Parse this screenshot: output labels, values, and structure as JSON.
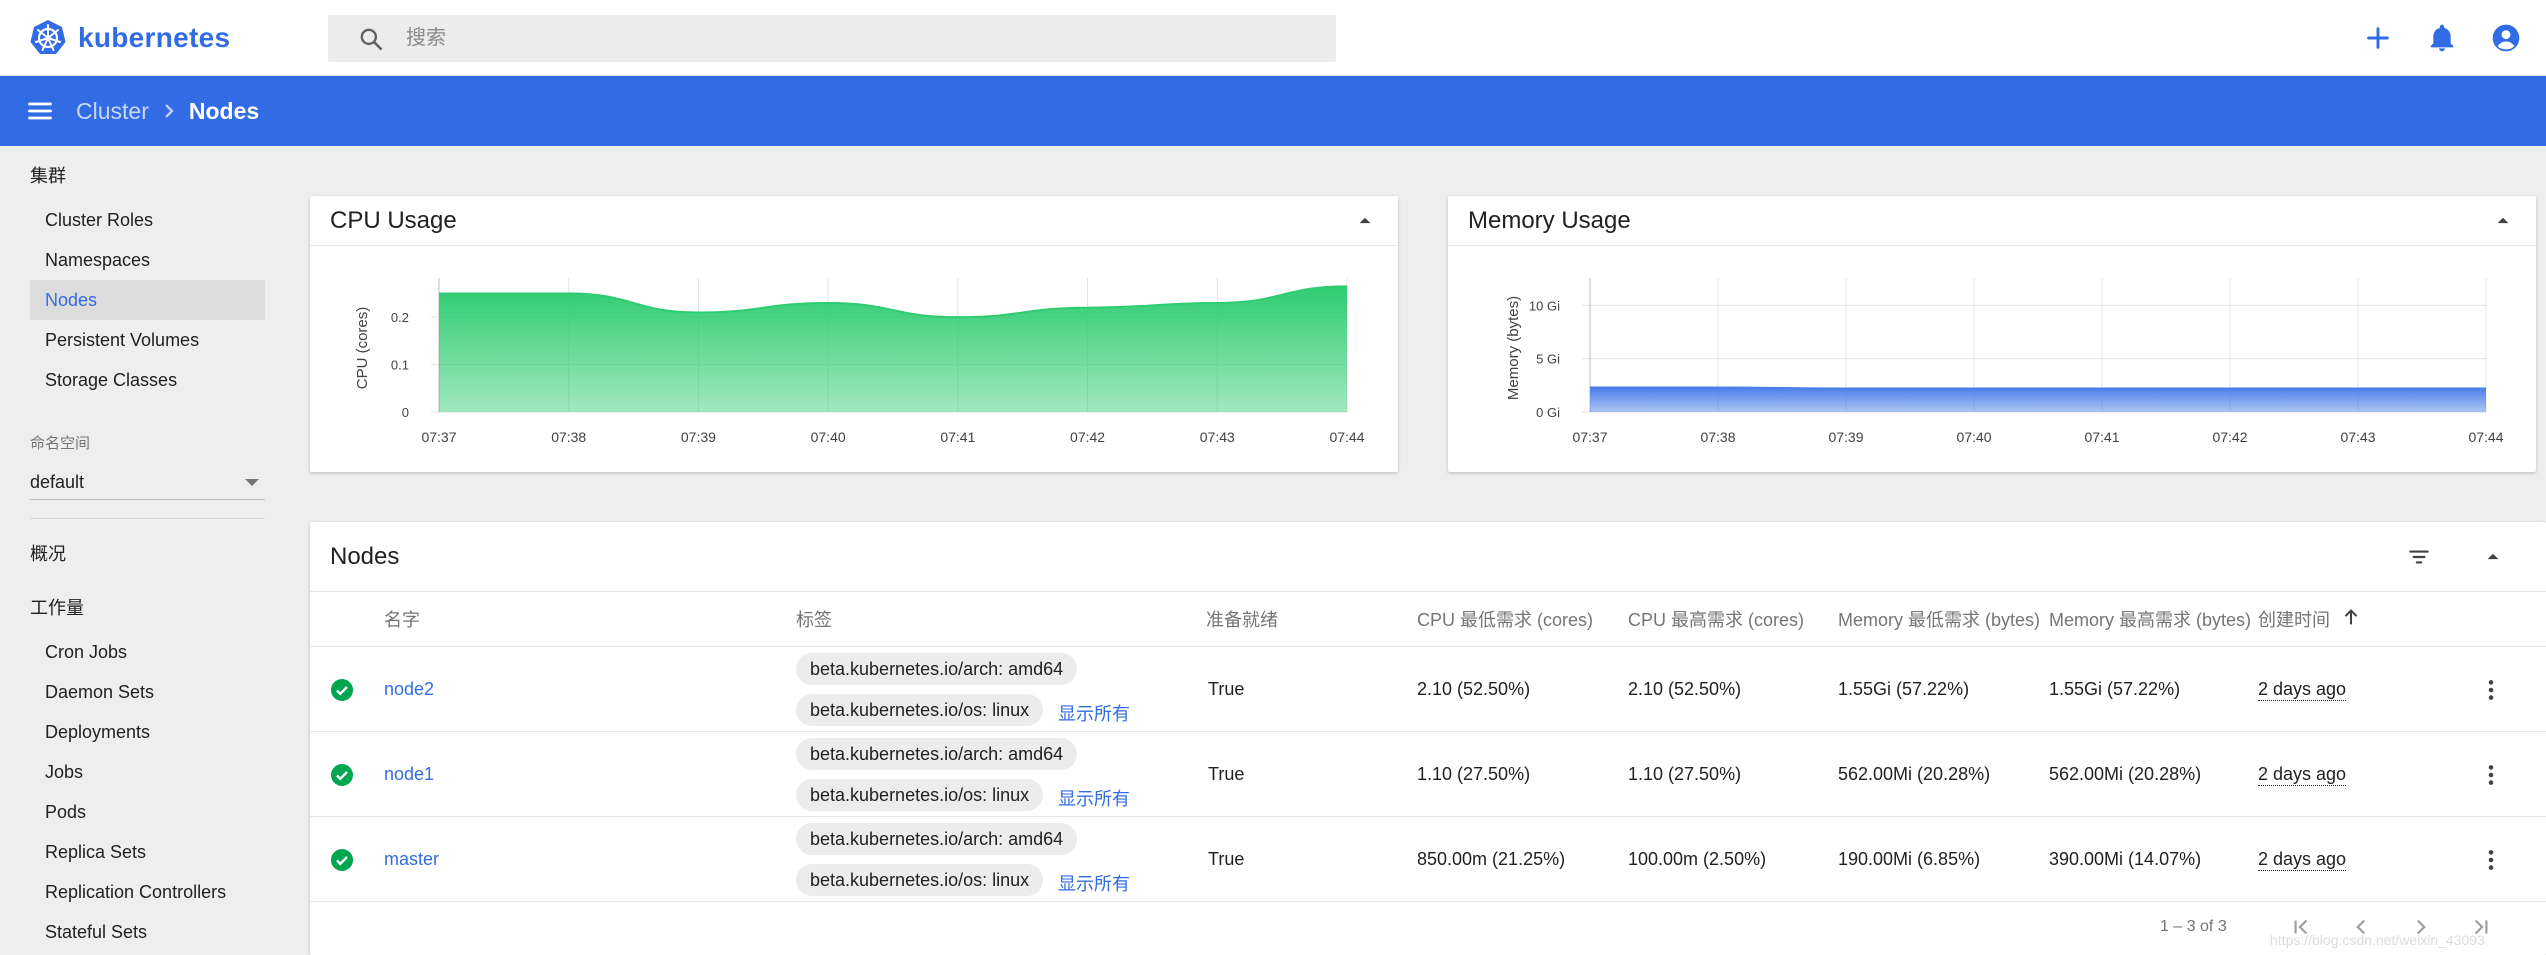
{
  "app": {
    "logo_text": "kubernetes"
  },
  "search": {
    "placeholder": "搜索"
  },
  "breadcrumb": {
    "parent": "Cluster",
    "current": "Nodes"
  },
  "sidebar": {
    "cluster_heading": "集群",
    "cluster_items": [
      {
        "label": "Cluster Roles",
        "active": false
      },
      {
        "label": "Namespaces",
        "active": false
      },
      {
        "label": "Nodes",
        "active": true
      },
      {
        "label": "Persistent Volumes",
        "active": false
      },
      {
        "label": "Storage Classes",
        "active": false
      }
    ],
    "namespace_label": "命名空间",
    "namespace_value": "default",
    "overview_heading": "概况",
    "workloads_heading": "工作量",
    "workload_items": [
      {
        "label": "Cron Jobs"
      },
      {
        "label": "Daemon Sets"
      },
      {
        "label": "Deployments"
      },
      {
        "label": "Jobs"
      },
      {
        "label": "Pods"
      },
      {
        "label": "Replica Sets"
      },
      {
        "label": "Replication Controllers"
      },
      {
        "label": "Stateful Sets"
      }
    ]
  },
  "cpu_card": {
    "title": "CPU Usage"
  },
  "memory_card": {
    "title": "Memory Usage"
  },
  "chart_data": [
    {
      "type": "area",
      "title": "CPU Usage",
      "ylabel": "CPU (cores)",
      "xlabel": "",
      "x": [
        "07:37",
        "07:38",
        "07:39",
        "07:40",
        "07:41",
        "07:42",
        "07:43",
        "07:44"
      ],
      "y_ticks": [
        "0",
        "0.1",
        "0.2"
      ],
      "ylim": [
        0,
        0.27
      ],
      "series": [
        {
          "values": [
            0.25,
            0.25,
            0.21,
            0.23,
            0.2,
            0.22,
            0.23,
            0.265
          ]
        }
      ],
      "color": "#2ecc71",
      "grid": true
    },
    {
      "type": "area",
      "title": "Memory Usage",
      "ylabel": "Memory (bytes)",
      "xlabel": "",
      "x": [
        "07:37",
        "07:38",
        "07:39",
        "07:40",
        "07:41",
        "07:42",
        "07:43",
        "07:44"
      ],
      "y_ticks": [
        "0 Gi",
        "5 Gi",
        "10 Gi"
      ],
      "ylim": [
        0,
        12
      ],
      "series": [
        {
          "values": [
            2.3,
            2.3,
            2.2,
            2.2,
            2.2,
            2.2,
            2.2,
            2.2
          ]
        }
      ],
      "color": "#4a7ee8",
      "grid": true
    }
  ],
  "nodes": {
    "title": "Nodes",
    "columns": [
      "名字",
      "标签",
      "准备就绪",
      "CPU 最低需求 (cores)",
      "CPU 最高需求 (cores)",
      "Memory 最低需求 (bytes)",
      "Memory 最高需求 (bytes)",
      "创建时间"
    ],
    "show_all_label": "显示所有",
    "rows": [
      {
        "name": "node2",
        "labels": [
          "beta.kubernetes.io/arch: amd64",
          "beta.kubernetes.io/os: linux"
        ],
        "ready": "True",
        "cpu_req": "2.10 (52.50%)",
        "cpu_lim": "2.10 (52.50%)",
        "mem_req": "1.55Gi (57.22%)",
        "mem_lim": "1.55Gi (57.22%)",
        "created": "2 days ago"
      },
      {
        "name": "node1",
        "labels": [
          "beta.kubernetes.io/arch: amd64",
          "beta.kubernetes.io/os: linux"
        ],
        "ready": "True",
        "cpu_req": "1.10 (27.50%)",
        "cpu_lim": "1.10 (27.50%)",
        "mem_req": "562.00Mi (20.28%)",
        "mem_lim": "562.00Mi (20.28%)",
        "created": "2 days ago"
      },
      {
        "name": "master",
        "labels": [
          "beta.kubernetes.io/arch: amd64",
          "beta.kubernetes.io/os: linux"
        ],
        "ready": "True",
        "cpu_req": "850.00m (21.25%)",
        "cpu_lim": "100.00m (2.50%)",
        "mem_req": "190.00Mi (6.85%)",
        "mem_lim": "390.00Mi (14.07%)",
        "created": "2 days ago"
      }
    ],
    "pagination": "1 – 3 of 3"
  },
  "watermark": "https://blog.csdn.net/weixin_43093"
}
